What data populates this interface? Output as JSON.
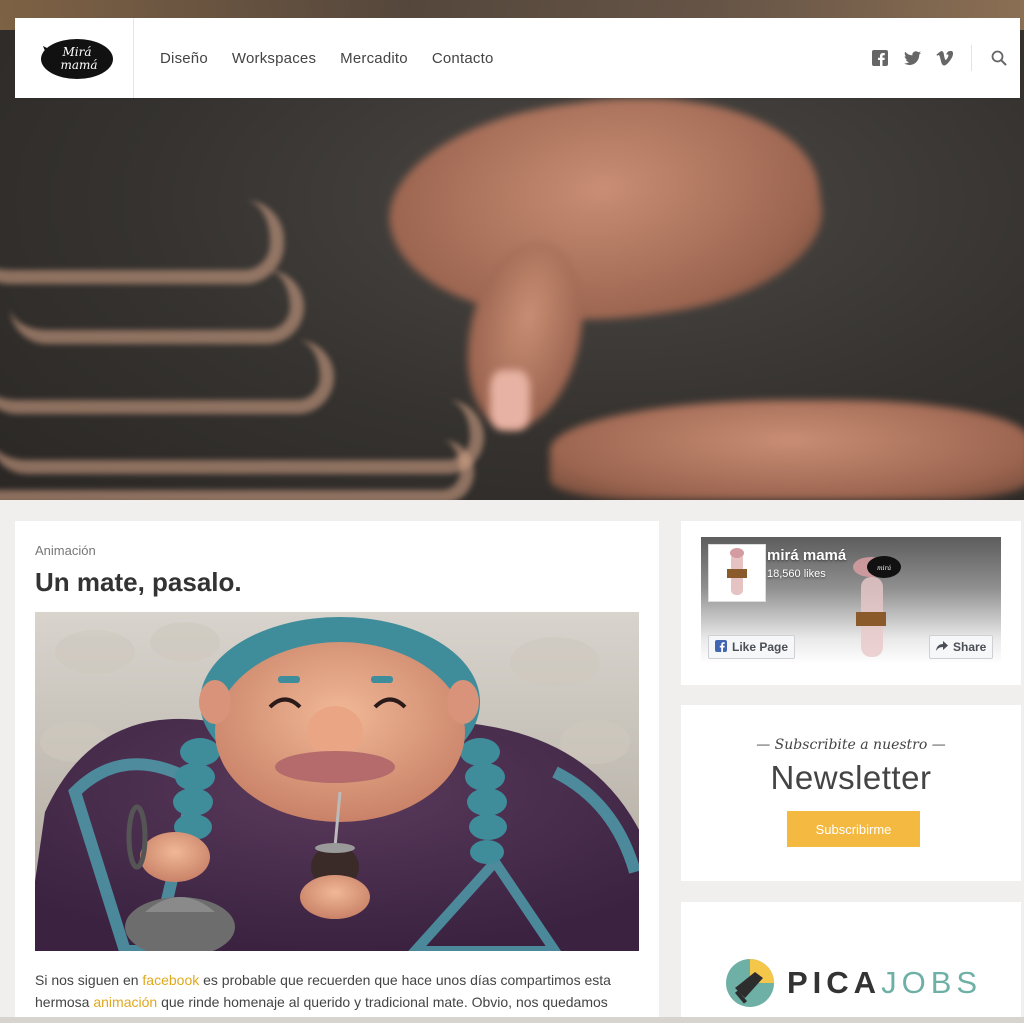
{
  "header": {
    "logo_text": "Mirá mamá",
    "nav": [
      {
        "label": "Diseño"
      },
      {
        "label": "Workspaces"
      },
      {
        "label": "Mercadito"
      },
      {
        "label": "Contacto"
      }
    ],
    "social_icons": [
      "facebook-icon",
      "twitter-icon",
      "vimeo-icon"
    ],
    "search_icon": "search-icon"
  },
  "post": {
    "category": "Animación",
    "title": "Un mate, pasalo.",
    "excerpt": {
      "p1": "Si nos siguen en ",
      "link1": "facebook",
      "p2": " es probable que recuerden que hace unos días compartimos esta",
      "p3": "hermosa ",
      "link2": "animación",
      "p4": " que rinde homenaje al querido y tradicional mate. Obvio, nos quedamos"
    }
  },
  "sidebar": {
    "facebook": {
      "page_name": "mirá mamá",
      "likes": "18,560 likes",
      "like_button": "Like Page",
      "share_button": "Share"
    },
    "newsletter": {
      "subtitle": "— Subscribite a nuestro —",
      "title": "Newsletter",
      "button": "Subscribirme"
    },
    "sponsor": {
      "brand_a": "PICA",
      "brand_b": "JOBS"
    }
  },
  "colors": {
    "accent": "#e0a81c",
    "newsletter_button": "#f4b940",
    "background": "#f0efee",
    "pica_teal": "#6fb0a6"
  }
}
